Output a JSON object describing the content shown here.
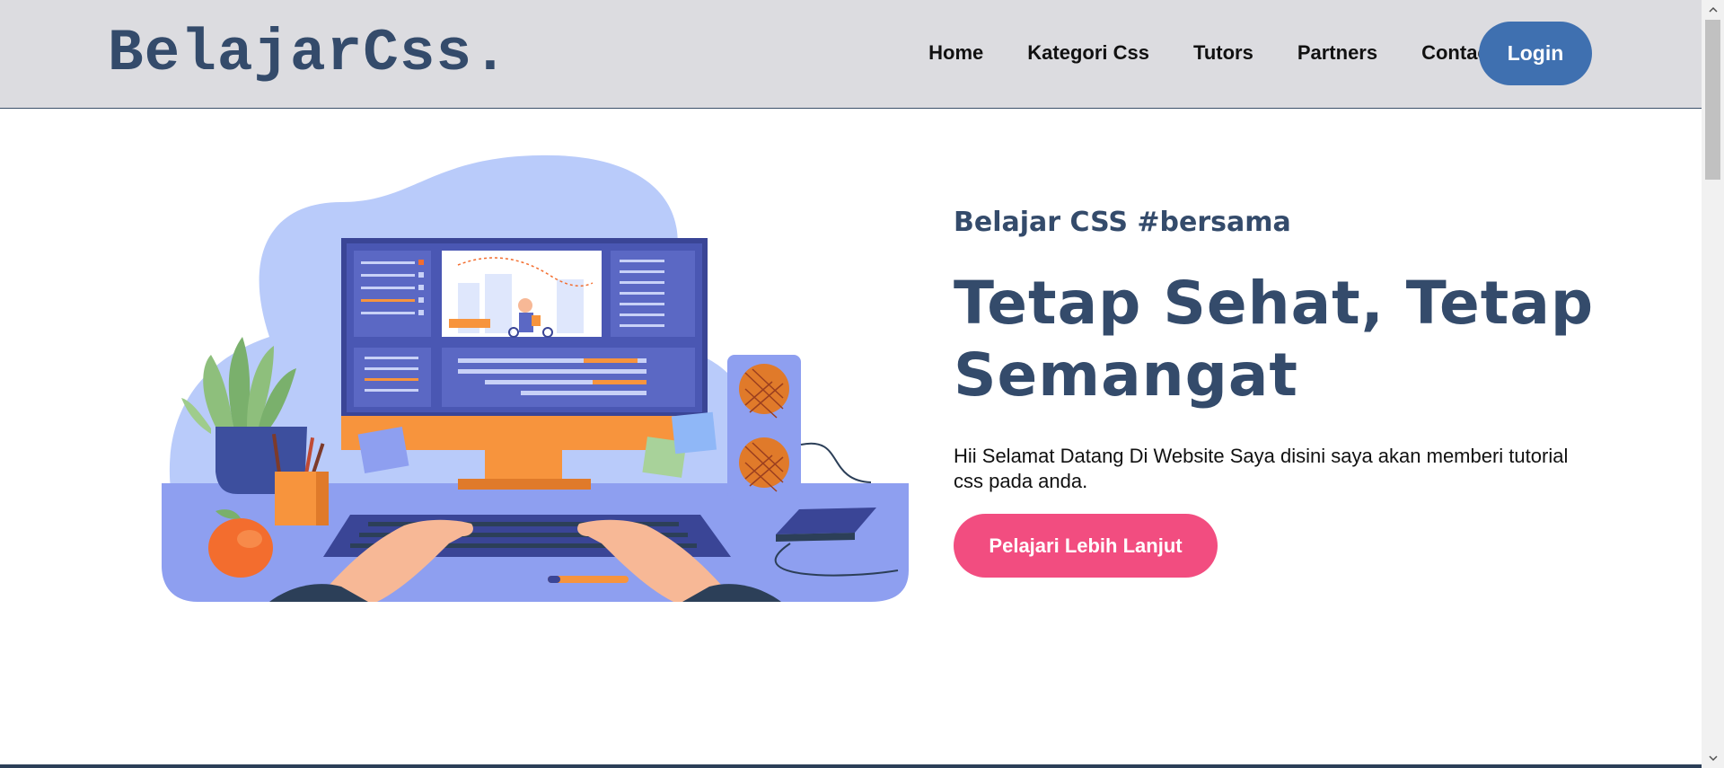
{
  "brand": {
    "logo": "BelajarCss."
  },
  "nav": {
    "items": [
      {
        "label": "Home"
      },
      {
        "label": "Kategori Css"
      },
      {
        "label": "Tutors"
      },
      {
        "label": "Partners"
      },
      {
        "label": "Contact"
      }
    ],
    "login_label": "Login"
  },
  "hero": {
    "subtitle": "Belajar CSS #bersama",
    "headline": "Tetap Sehat, Tetap Semangat",
    "description": "Hii Selamat Datang Di Website Saya disini saya akan memberi tutorial css pada anda.",
    "cta_label": "Pelajari Lebih Lanjut"
  },
  "colors": {
    "navbar_bg": "#dcdce0",
    "brand_text": "#344b6b",
    "login_button": "#3f70b0",
    "cta_button": "#f24d80",
    "illustration_blob": "#b9cbfa",
    "monitor_screen": "#4a57b3",
    "desk_orange": "#f7943d"
  },
  "illustration": {
    "name": "computer-desk-illustration"
  },
  "icons": {
    "scroll_up": "chevron-up-icon",
    "scroll_down": "chevron-down-icon"
  }
}
